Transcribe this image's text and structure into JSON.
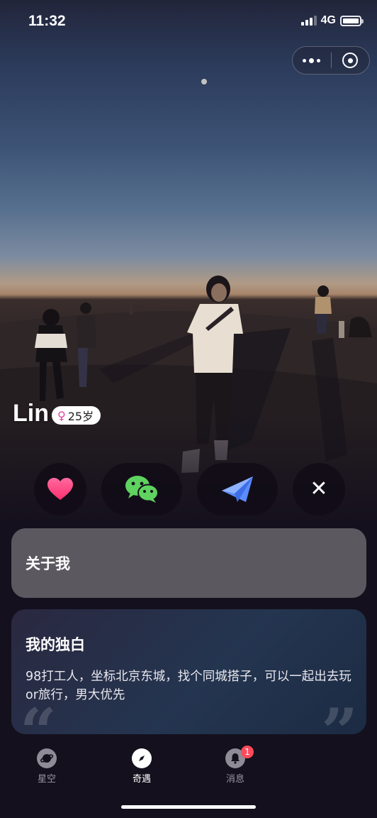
{
  "status_bar": {
    "time": "11:32",
    "network": "4G"
  },
  "capsule": {
    "more_icon": "more-dots-icon",
    "close_icon": "target-circle-icon"
  },
  "profile": {
    "name": "Lin",
    "gender_icon": "female-icon",
    "gender_symbol": "♀",
    "age": "25岁"
  },
  "actions": {
    "like_icon": "heart-icon",
    "wechat_icon": "wechat-icon",
    "send_icon": "paper-plane-icon",
    "close_icon": "close-icon",
    "close_symbol": "✕"
  },
  "cards": {
    "about": {
      "title": "关于我"
    },
    "monologue": {
      "title": "我的独白",
      "text": "98打工人，坐标北京东城，找个同城搭子，可以一起出去玩or旅行，男大优先",
      "quote_open": "“",
      "quote_close": "”"
    }
  },
  "tab_bar": {
    "tabs": [
      {
        "label": "星空",
        "icon": "planet-icon",
        "active": false
      },
      {
        "label": "奇遇",
        "icon": "compass-icon",
        "active": true
      },
      {
        "label": "消息",
        "icon": "bell-icon",
        "active": false,
        "badge": "1"
      }
    ]
  },
  "colors": {
    "accent_pink": "#ff4f8b",
    "wechat_green": "#5fd35f",
    "plane_blue": "#5b8cff",
    "badge_red": "#ff4a5c"
  }
}
